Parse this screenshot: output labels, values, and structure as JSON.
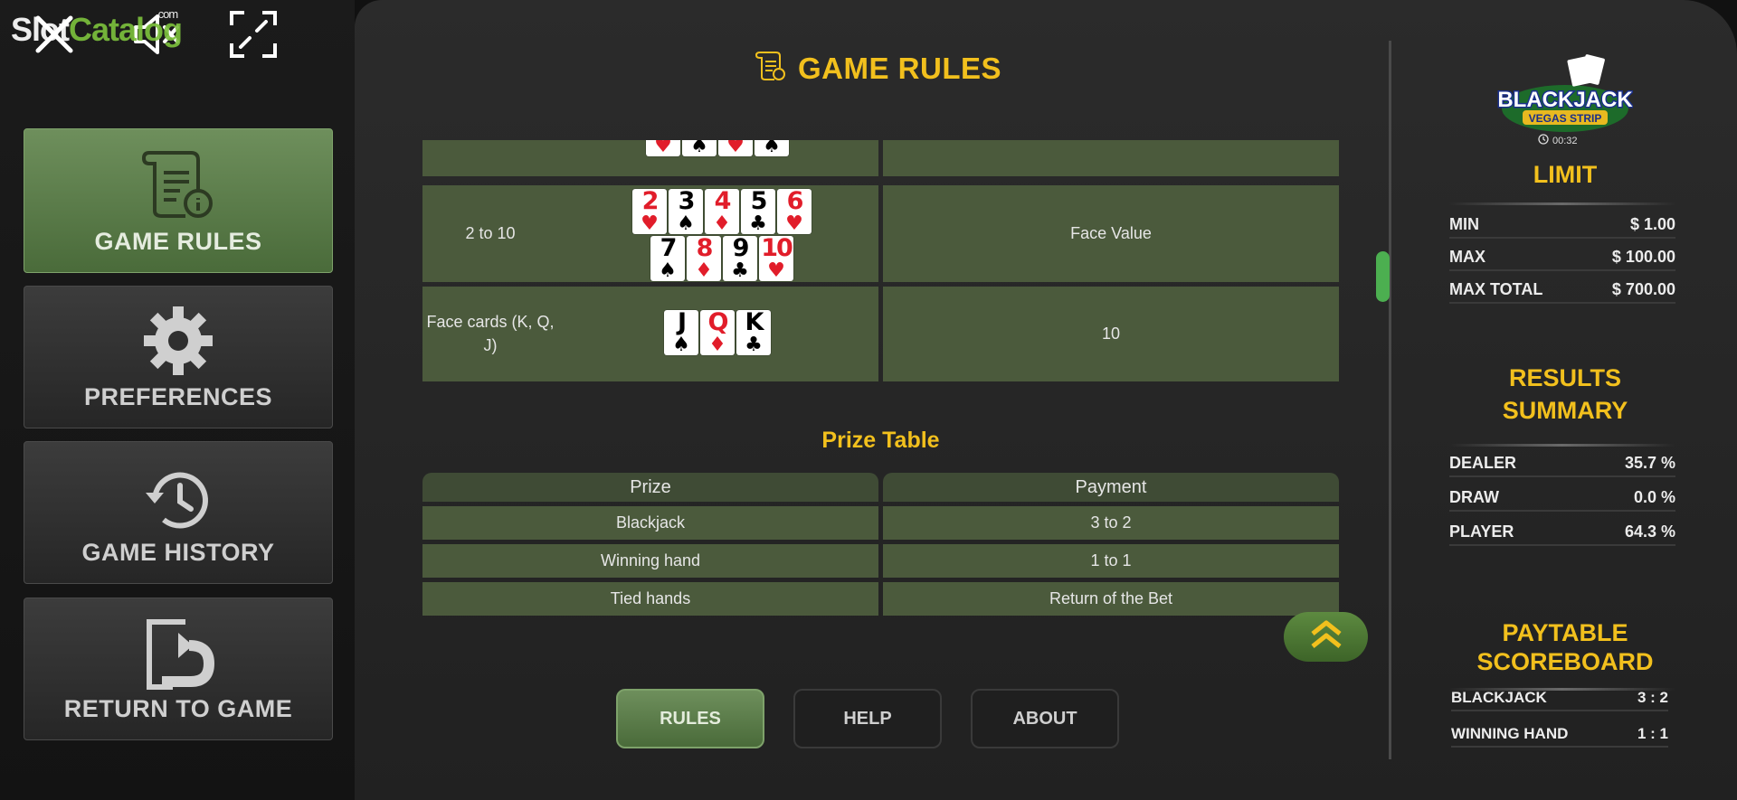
{
  "watermark": {
    "part1": "Slot",
    "part2": "Catalog",
    "part3": ".com"
  },
  "sidebar": {
    "items": [
      {
        "label": "GAME RULES",
        "active": true,
        "icon": "rules-scroll-icon"
      },
      {
        "label": "PREFERENCES",
        "active": false,
        "icon": "gear-icon"
      },
      {
        "label": "GAME HISTORY",
        "active": false,
        "icon": "history-icon"
      },
      {
        "label": "RETURN TO GAME",
        "active": false,
        "icon": "return-icon"
      }
    ]
  },
  "main": {
    "title": "GAME RULES",
    "card_values": [
      {
        "desc": "2 to 10",
        "value": "Face Value",
        "cards": [
          {
            "rank": "2",
            "suit": "♥",
            "color": "red"
          },
          {
            "rank": "3",
            "suit": "♠",
            "color": "blk"
          },
          {
            "rank": "4",
            "suit": "♦",
            "color": "red"
          },
          {
            "rank": "5",
            "suit": "♣",
            "color": "blk"
          },
          {
            "rank": "6",
            "suit": "♥",
            "color": "red"
          },
          {
            "rank": "7",
            "suit": "♠",
            "color": "blk"
          },
          {
            "rank": "8",
            "suit": "♦",
            "color": "red"
          },
          {
            "rank": "9",
            "suit": "♣",
            "color": "blk"
          },
          {
            "rank": "10",
            "suit": "♥",
            "color": "red"
          }
        ]
      },
      {
        "desc": "Face cards (K, Q, J)",
        "value": "10",
        "cards": [
          {
            "rank": "J",
            "suit": "♠",
            "color": "blk"
          },
          {
            "rank": "Q",
            "suit": "♦",
            "color": "red"
          },
          {
            "rank": "K",
            "suit": "♣",
            "color": "blk"
          }
        ]
      }
    ],
    "partial_cards": [
      {
        "suit": "♥",
        "color": "red"
      },
      {
        "suit": "♠",
        "color": "blk"
      },
      {
        "suit": "♥",
        "color": "red"
      },
      {
        "suit": "♠",
        "color": "blk"
      }
    ],
    "prize_table": {
      "title": "Prize Table",
      "headers": [
        "Prize",
        "Payment"
      ],
      "rows": [
        [
          "Blackjack",
          "3 to 2"
        ],
        [
          "Winning hand",
          "1 to 1"
        ],
        [
          "Tied hands",
          "Return of the Bet"
        ]
      ]
    },
    "tabs": [
      {
        "label": "RULES",
        "active": true
      },
      {
        "label": "HELP",
        "active": false
      },
      {
        "label": "ABOUT",
        "active": false
      }
    ]
  },
  "right": {
    "timer": "00:32",
    "limit": {
      "title": "LIMIT",
      "rows": [
        {
          "k": "MIN",
          "v": "$ 1.00"
        },
        {
          "k": "MAX",
          "v": "$ 100.00"
        },
        {
          "k": "MAX TOTAL",
          "v": "$ 700.00"
        }
      ]
    },
    "results": {
      "title_line1": "RESULTS",
      "title_line2": "SUMMARY",
      "rows": [
        {
          "k": "DEALER",
          "v": "35.7 %"
        },
        {
          "k": "DRAW",
          "v": "0.0 %"
        },
        {
          "k": "PLAYER",
          "v": "64.3 %"
        }
      ]
    },
    "paytable": {
      "title_line1": "PAYTABLE",
      "title_line2": "SCOREBOARD",
      "rows": [
        {
          "k": "BLACKJACK",
          "v": "3 : 2"
        },
        {
          "k": "WINNING HAND",
          "v": "1 : 1"
        }
      ]
    }
  },
  "colors": {
    "accent": "#f2c01d",
    "active_green": "#5e7e4b",
    "cell": "#4b5a3c",
    "scroll": "#4caf50"
  }
}
